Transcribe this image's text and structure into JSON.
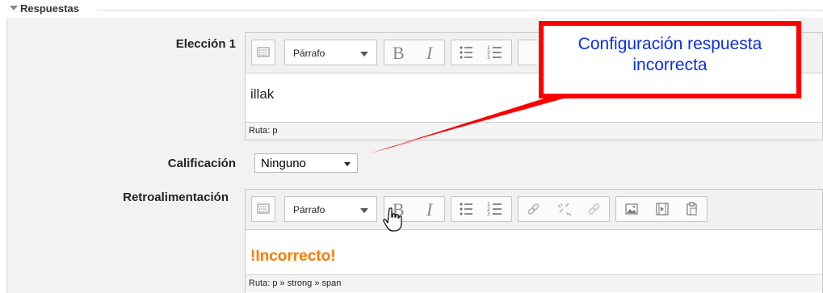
{
  "section": {
    "legend": "Respuestas"
  },
  "fields": {
    "choice_label": "Elección 1",
    "grade_label": "Calificación",
    "feedback_label": "Retroalimentación"
  },
  "choice_editor": {
    "format": "Párrafo",
    "content": "illak",
    "path": "Ruta: p"
  },
  "grade": {
    "selected": "Ninguno"
  },
  "feedback_editor": {
    "format": "Párrafo",
    "content": "!Incorrecto!",
    "content_color": "#ff7a00",
    "path": "Ruta: p » strong » span"
  },
  "callout": {
    "line1": "Configuración respuesta",
    "line2": "incorrecta",
    "border_color": "#ff0000",
    "text_color": "#0a2fe0"
  },
  "toolbar": {
    "bold": "B",
    "italic": "I"
  },
  "icons": [
    "collapse-arrow-icon",
    "toolbar-toggle-icon",
    "bullet-list-icon",
    "numbered-list-icon",
    "link-icon",
    "unlink-icon",
    "anchor-icon",
    "image-icon",
    "media-icon",
    "paste-icon",
    "hand-cursor-icon"
  ]
}
